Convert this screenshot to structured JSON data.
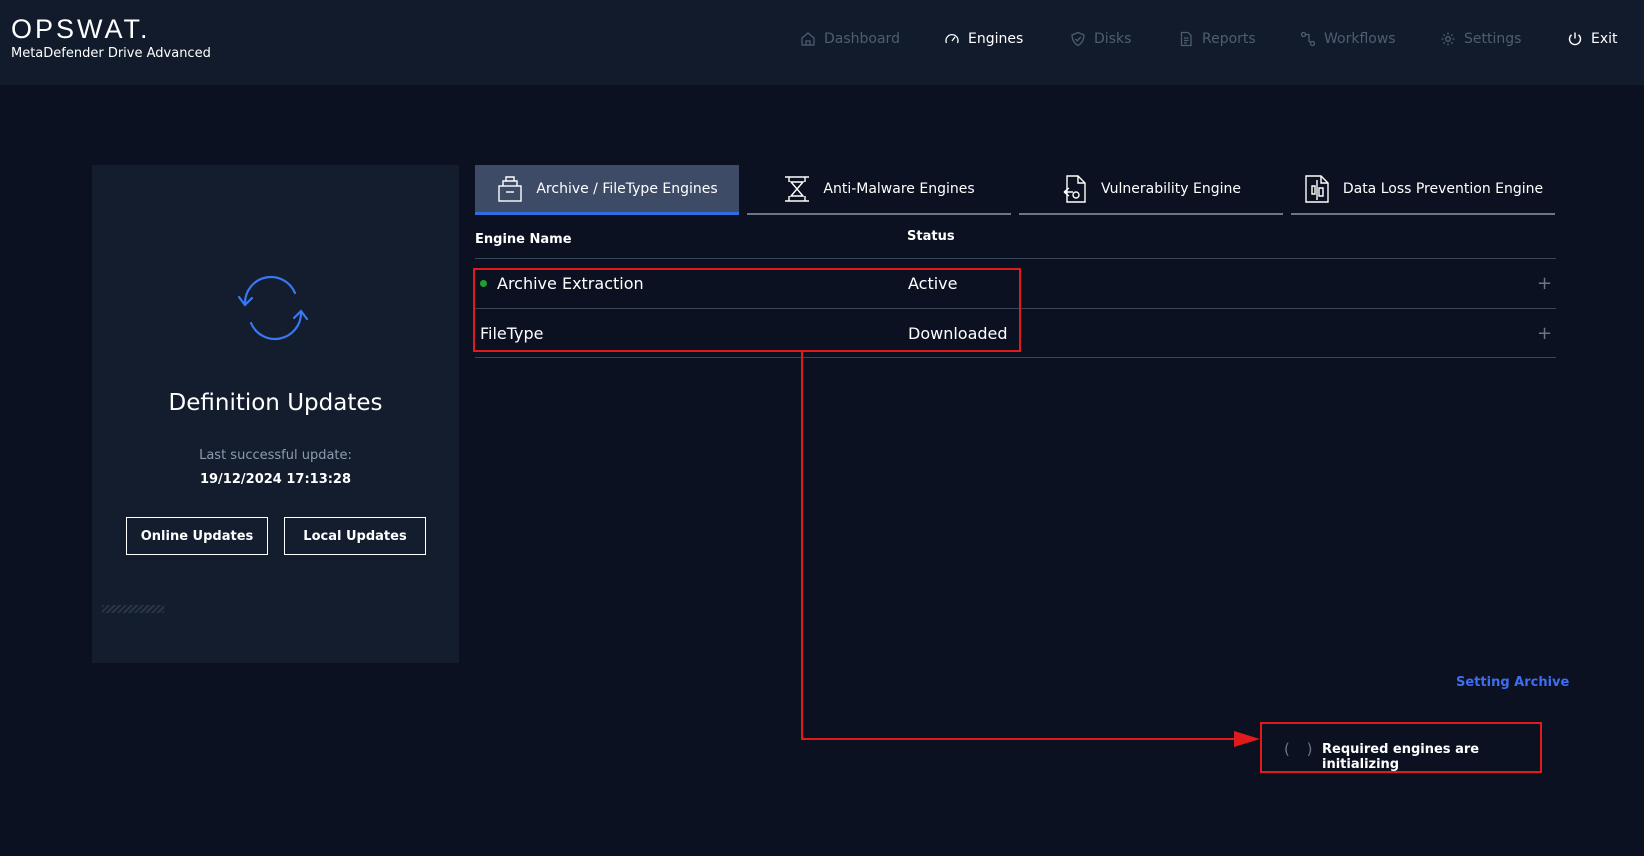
{
  "header": {
    "logo": "OPSWAT.",
    "product": "MetaDefender Drive Advanced",
    "nav": [
      {
        "label": "Dashboard",
        "icon": "home-icon"
      },
      {
        "label": "Engines",
        "icon": "gauge-icon"
      },
      {
        "label": "Disks",
        "icon": "check-shield-icon"
      },
      {
        "label": "Reports",
        "icon": "document-icon"
      },
      {
        "label": "Workflows",
        "icon": "workflow-icon"
      },
      {
        "label": "Settings",
        "icon": "gear-icon"
      },
      {
        "label": "Exit",
        "icon": "power-icon"
      }
    ]
  },
  "definitions": {
    "title": "Definition Updates",
    "last_label": "Last successful update:",
    "last_date": "19/12/2024 17:13:28",
    "online_button": "Online Updates",
    "local_button": "Local Updates"
  },
  "tabs": [
    {
      "label": "Archive / FileType Engines",
      "icon": "archive-icon",
      "active": true
    },
    {
      "label": "Anti-Malware Engines",
      "icon": "antimalware-icon",
      "active": false
    },
    {
      "label": "Vulnerability Engine",
      "icon": "vulnerability-icon",
      "active": false
    },
    {
      "label": "Data Loss Prevention Engine",
      "icon": "dlp-icon",
      "active": false
    }
  ],
  "table": {
    "headers": {
      "name": "Engine Name",
      "status": "Status"
    },
    "rows": [
      {
        "name": "Archive Extraction",
        "status": "Active",
        "indicator": "green"
      },
      {
        "name": "FileType",
        "status": "Downloaded",
        "indicator": ""
      }
    ]
  },
  "footer": {
    "setting_link": "Setting Archive",
    "init_spinner": "( )",
    "init_text": "Required engines are initializing"
  },
  "colors": {
    "background": "#0b1120",
    "header": "#111b2b",
    "accent": "#2e6ce6",
    "annotation": "#e01b1b",
    "status_active": "#1fa12f"
  }
}
